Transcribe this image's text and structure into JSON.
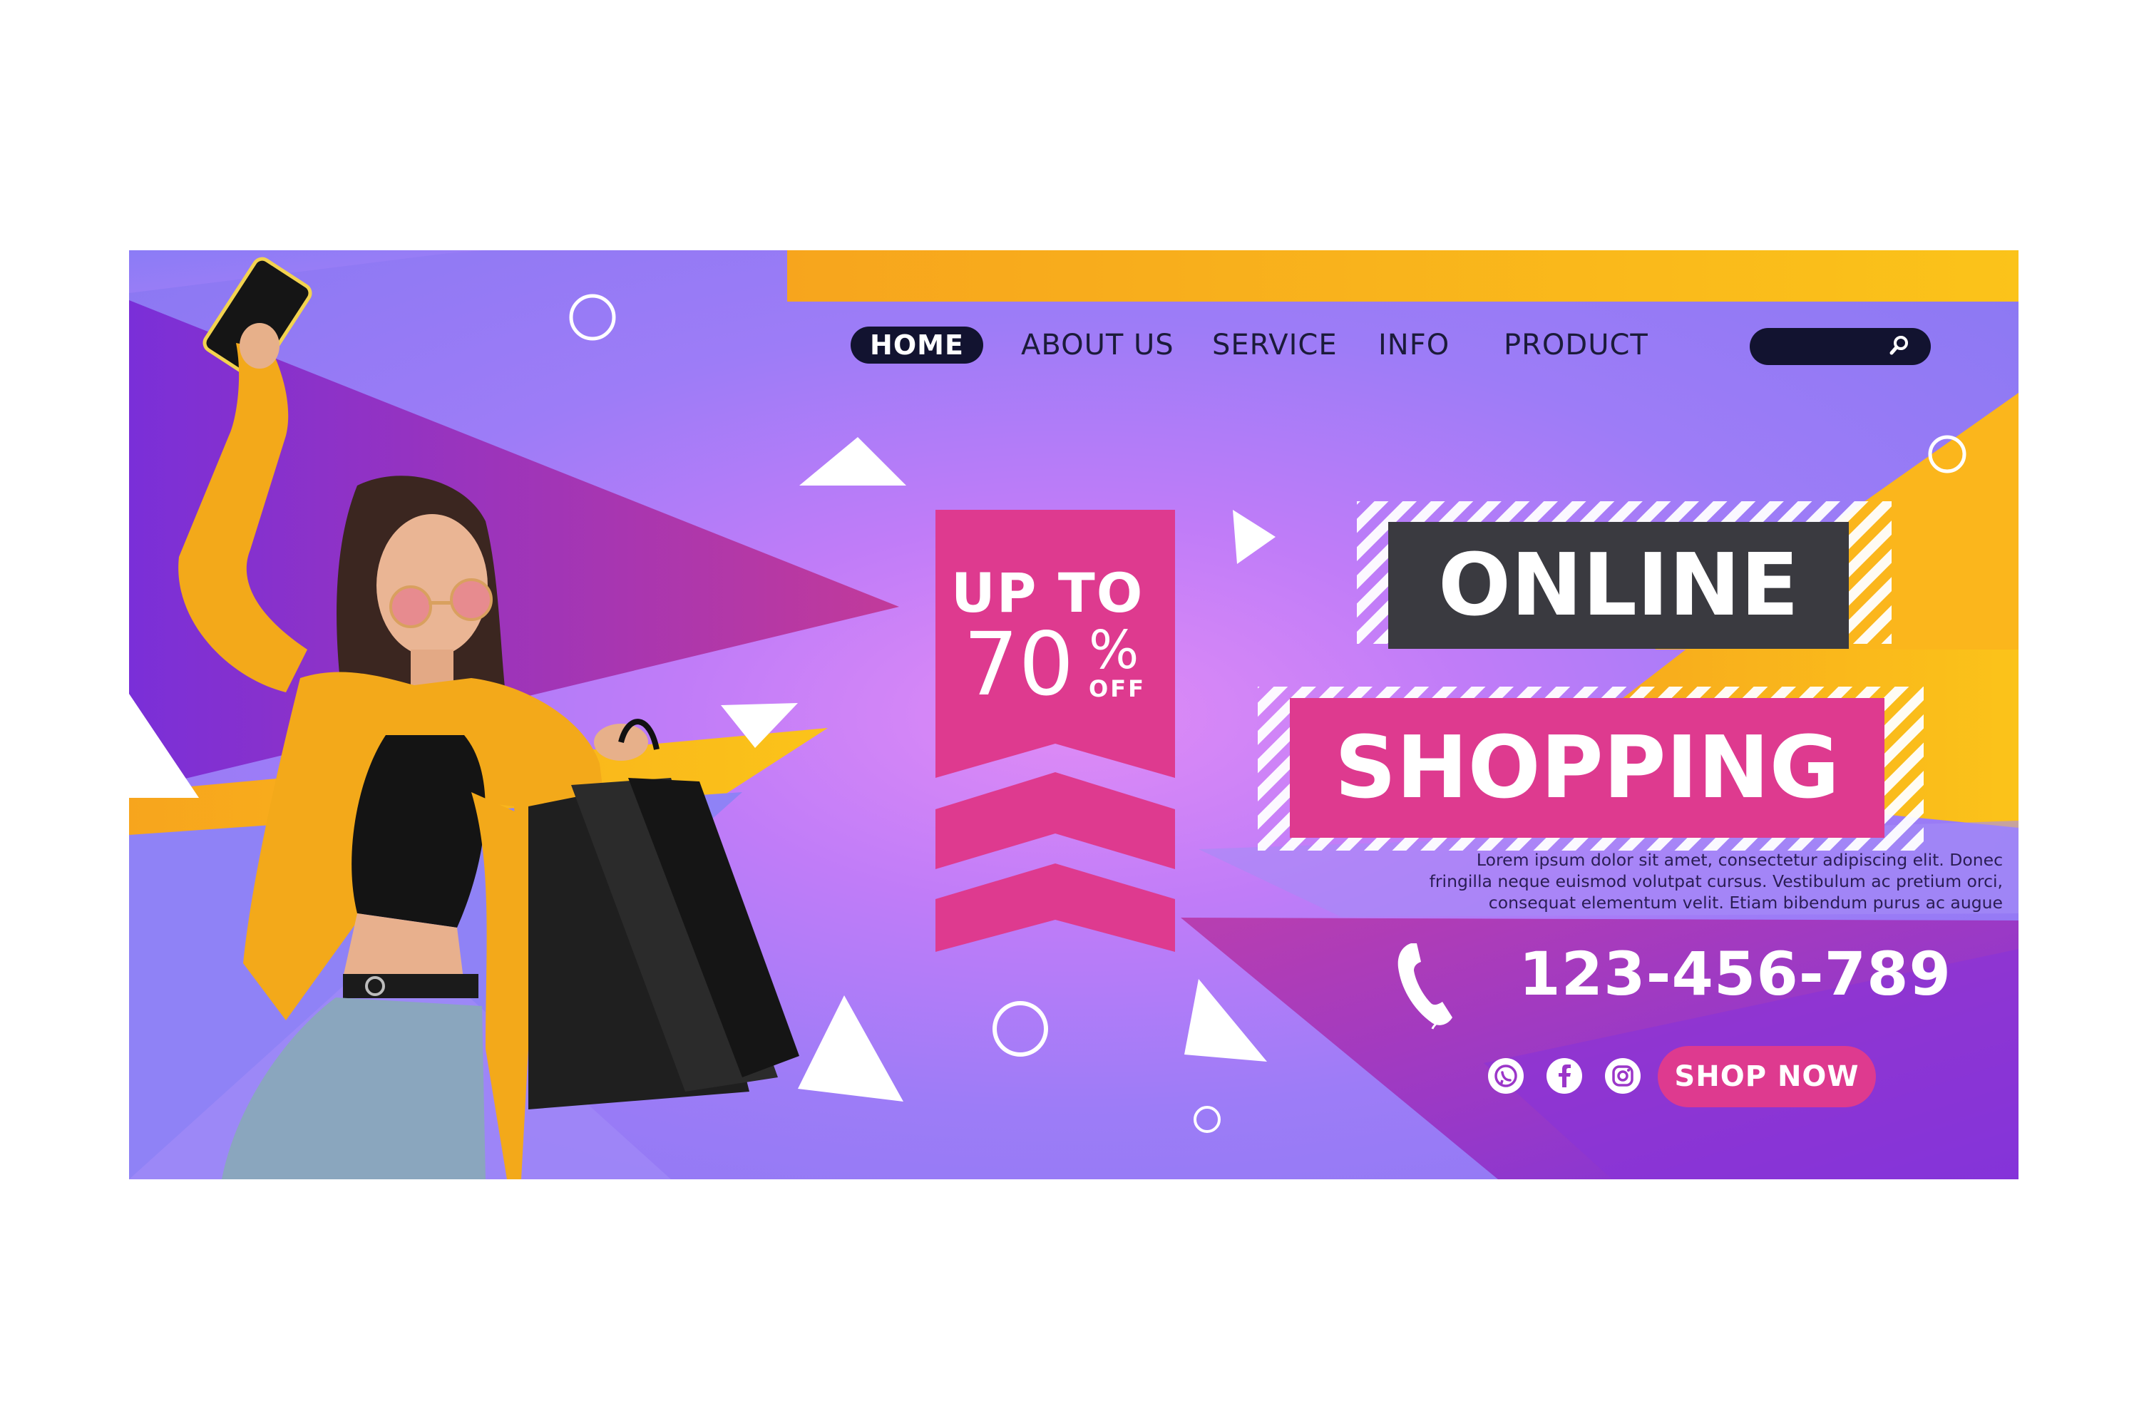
{
  "nav": {
    "items": [
      "HOME",
      "ABOUT US",
      "SERVICE",
      "INFO",
      "PRODUCT"
    ],
    "active": "HOME"
  },
  "search": {
    "placeholder": ""
  },
  "promo": {
    "line1": "UP TO",
    "number": "70",
    "percent": "%",
    "off": "OFF"
  },
  "headline": {
    "line1": "ONLINE",
    "line2": "SHOPPING"
  },
  "description": {
    "line1": "Lorem ipsum dolor sit amet, consectetur adipiscing elit. Donec",
    "line2": "fringilla neque euismod volutpat cursus. Vestibulum ac pretium orci,",
    "line3": "consequat elementum velit. Etiam bibendum purus ac augue"
  },
  "contact": {
    "phone": "123-456-789"
  },
  "cta": {
    "label": "SHOP NOW"
  },
  "social": [
    "whatsapp-icon",
    "facebook-icon",
    "instagram-icon"
  ],
  "colors": {
    "pink": "#de3a8f",
    "navy": "#121330",
    "yellow": "#f9b21d",
    "purple": "#8a3de0",
    "dark_box": "#3a3a40"
  }
}
